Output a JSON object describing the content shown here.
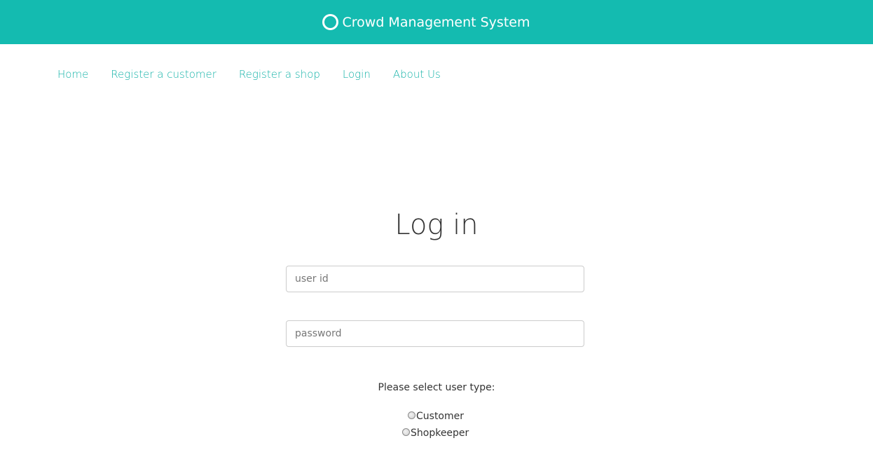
{
  "colors": {
    "brand_teal": "#14bbb0",
    "link_teal": "#14b3a8"
  },
  "header": {
    "icon": "ring-icon",
    "title": "Crowd Management System"
  },
  "nav": {
    "items": [
      {
        "label": "Home"
      },
      {
        "label": "Register a customer"
      },
      {
        "label": "Register a shop"
      },
      {
        "label": "Login"
      },
      {
        "label": "About Us"
      }
    ]
  },
  "login": {
    "title": "Log in",
    "userid_placeholder": "user id",
    "password_placeholder": "password",
    "user_type_prompt": "Please select user type:",
    "user_types": [
      {
        "label": "Customer"
      },
      {
        "label": "Shopkeeper"
      }
    ]
  }
}
